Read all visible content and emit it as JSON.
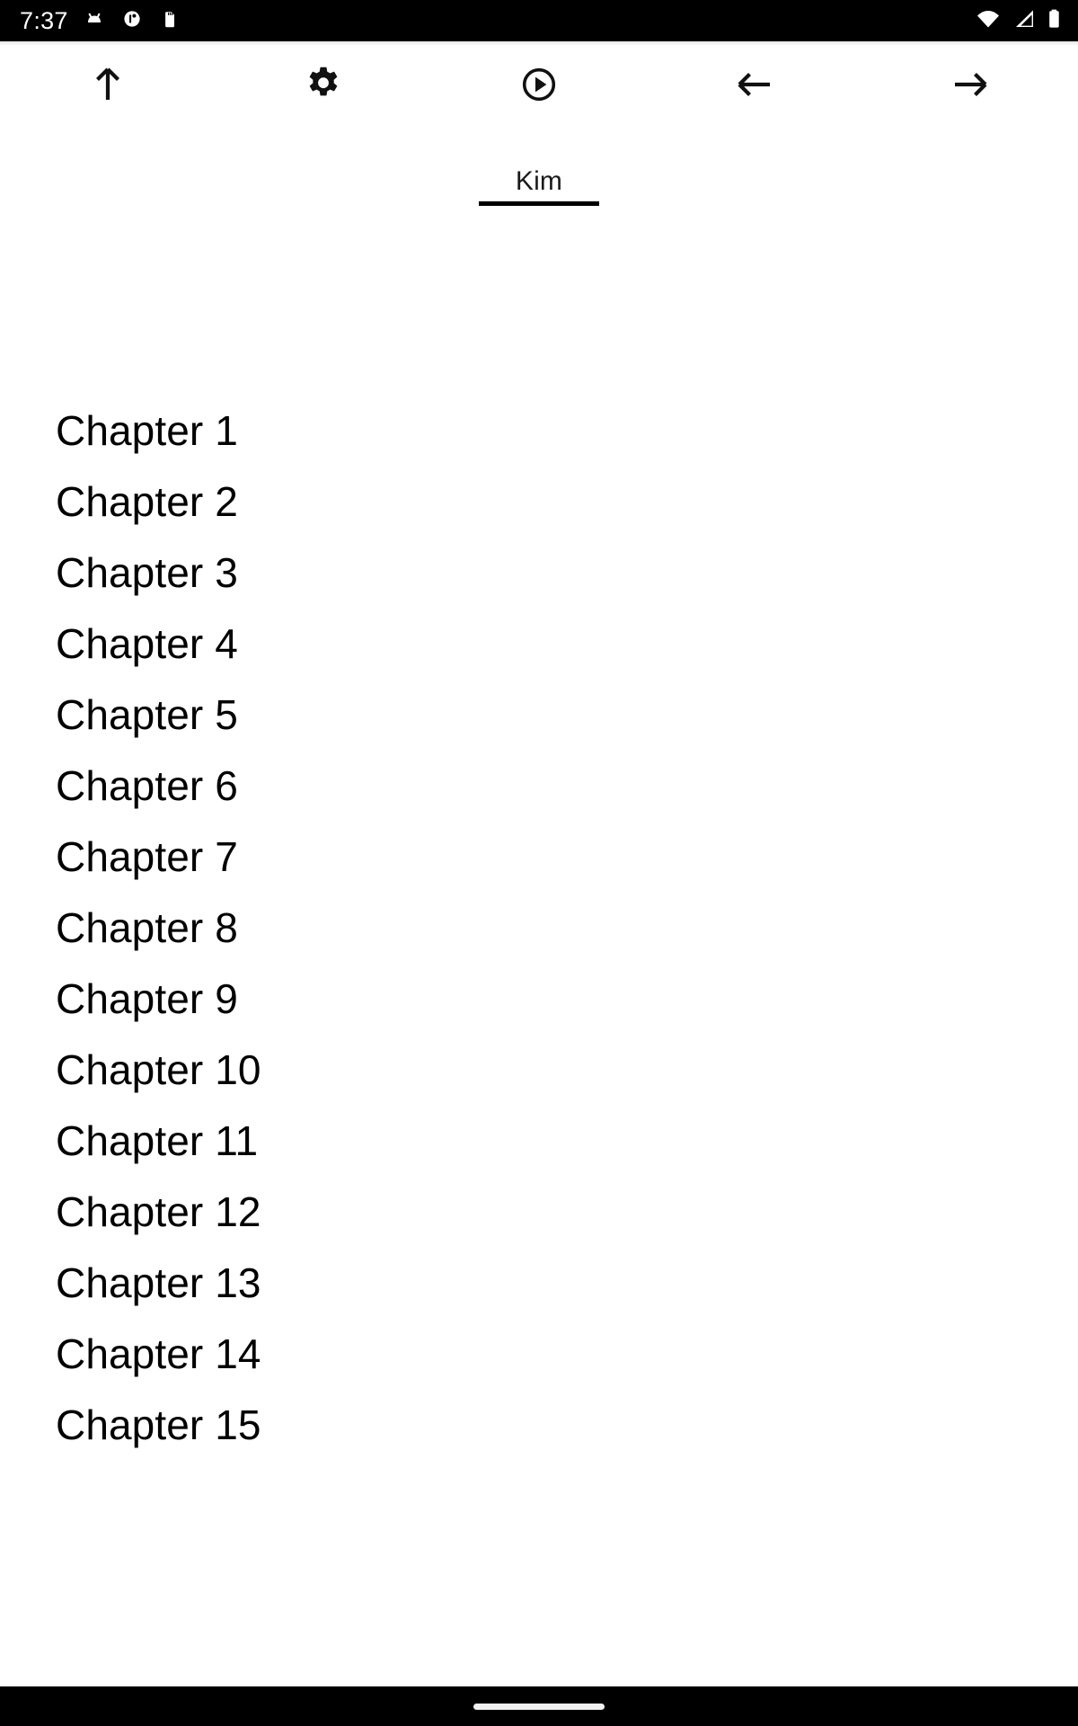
{
  "status_bar": {
    "time": "7:37",
    "left_icons": [
      {
        "name": "android-app-icon"
      },
      {
        "name": "circle-indicator-icon"
      },
      {
        "name": "sd-card-icon"
      }
    ],
    "right_icons": [
      {
        "name": "wifi-icon"
      },
      {
        "name": "cellular-signal-icon"
      },
      {
        "name": "battery-icon"
      }
    ],
    "background_color": "#000000",
    "foreground_color": "#ffffff"
  },
  "toolbar": {
    "buttons": [
      {
        "name": "scroll-up-button",
        "icon": "arrow-up-icon",
        "label": "Up"
      },
      {
        "name": "settings-button",
        "icon": "gear-icon",
        "label": "Settings"
      },
      {
        "name": "play-button",
        "icon": "play-circle-icon",
        "label": "Play"
      },
      {
        "name": "previous-button",
        "icon": "arrow-left-icon",
        "label": "Previous"
      },
      {
        "name": "next-button",
        "icon": "arrow-right-icon",
        "label": "Next"
      }
    ]
  },
  "title": {
    "text": "Kim",
    "underlined": true
  },
  "chapters": [
    {
      "label": "Chapter 1"
    },
    {
      "label": "Chapter 2"
    },
    {
      "label": "Chapter 3"
    },
    {
      "label": "Chapter 4"
    },
    {
      "label": "Chapter 5"
    },
    {
      "label": "Chapter 6"
    },
    {
      "label": "Chapter 7"
    },
    {
      "label": "Chapter 8"
    },
    {
      "label": "Chapter 9"
    },
    {
      "label": "Chapter 10"
    },
    {
      "label": "Chapter 11"
    },
    {
      "label": "Chapter 12"
    },
    {
      "label": "Chapter 13"
    },
    {
      "label": "Chapter 14"
    },
    {
      "label": "Chapter 15"
    }
  ],
  "nav_bar": {
    "home_indicator": true,
    "background_color": "#000000",
    "indicator_color": "#f1f1f1"
  },
  "colors": {
    "page_background": "#ffffff",
    "text": "#000000",
    "title_text": "#1a1a1a"
  }
}
